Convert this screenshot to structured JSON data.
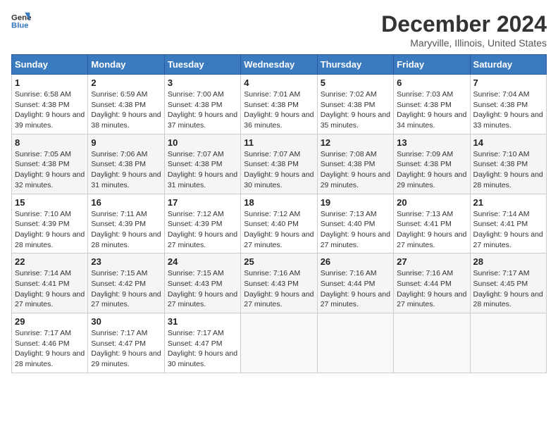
{
  "header": {
    "logo_line1": "General",
    "logo_line2": "Blue",
    "title": "December 2024",
    "subtitle": "Maryville, Illinois, United States"
  },
  "weekdays": [
    "Sunday",
    "Monday",
    "Tuesday",
    "Wednesday",
    "Thursday",
    "Friday",
    "Saturday"
  ],
  "weeks": [
    [
      {
        "day": "1",
        "sunrise": "Sunrise: 6:58 AM",
        "sunset": "Sunset: 4:38 PM",
        "daylight": "Daylight: 9 hours and 39 minutes."
      },
      {
        "day": "2",
        "sunrise": "Sunrise: 6:59 AM",
        "sunset": "Sunset: 4:38 PM",
        "daylight": "Daylight: 9 hours and 38 minutes."
      },
      {
        "day": "3",
        "sunrise": "Sunrise: 7:00 AM",
        "sunset": "Sunset: 4:38 PM",
        "daylight": "Daylight: 9 hours and 37 minutes."
      },
      {
        "day": "4",
        "sunrise": "Sunrise: 7:01 AM",
        "sunset": "Sunset: 4:38 PM",
        "daylight": "Daylight: 9 hours and 36 minutes."
      },
      {
        "day": "5",
        "sunrise": "Sunrise: 7:02 AM",
        "sunset": "Sunset: 4:38 PM",
        "daylight": "Daylight: 9 hours and 35 minutes."
      },
      {
        "day": "6",
        "sunrise": "Sunrise: 7:03 AM",
        "sunset": "Sunset: 4:38 PM",
        "daylight": "Daylight: 9 hours and 34 minutes."
      },
      {
        "day": "7",
        "sunrise": "Sunrise: 7:04 AM",
        "sunset": "Sunset: 4:38 PM",
        "daylight": "Daylight: 9 hours and 33 minutes."
      }
    ],
    [
      {
        "day": "8",
        "sunrise": "Sunrise: 7:05 AM",
        "sunset": "Sunset: 4:38 PM",
        "daylight": "Daylight: 9 hours and 32 minutes."
      },
      {
        "day": "9",
        "sunrise": "Sunrise: 7:06 AM",
        "sunset": "Sunset: 4:38 PM",
        "daylight": "Daylight: 9 hours and 31 minutes."
      },
      {
        "day": "10",
        "sunrise": "Sunrise: 7:07 AM",
        "sunset": "Sunset: 4:38 PM",
        "daylight": "Daylight: 9 hours and 31 minutes."
      },
      {
        "day": "11",
        "sunrise": "Sunrise: 7:07 AM",
        "sunset": "Sunset: 4:38 PM",
        "daylight": "Daylight: 9 hours and 30 minutes."
      },
      {
        "day": "12",
        "sunrise": "Sunrise: 7:08 AM",
        "sunset": "Sunset: 4:38 PM",
        "daylight": "Daylight: 9 hours and 29 minutes."
      },
      {
        "day": "13",
        "sunrise": "Sunrise: 7:09 AM",
        "sunset": "Sunset: 4:38 PM",
        "daylight": "Daylight: 9 hours and 29 minutes."
      },
      {
        "day": "14",
        "sunrise": "Sunrise: 7:10 AM",
        "sunset": "Sunset: 4:38 PM",
        "daylight": "Daylight: 9 hours and 28 minutes."
      }
    ],
    [
      {
        "day": "15",
        "sunrise": "Sunrise: 7:10 AM",
        "sunset": "Sunset: 4:39 PM",
        "daylight": "Daylight: 9 hours and 28 minutes."
      },
      {
        "day": "16",
        "sunrise": "Sunrise: 7:11 AM",
        "sunset": "Sunset: 4:39 PM",
        "daylight": "Daylight: 9 hours and 28 minutes."
      },
      {
        "day": "17",
        "sunrise": "Sunrise: 7:12 AM",
        "sunset": "Sunset: 4:39 PM",
        "daylight": "Daylight: 9 hours and 27 minutes."
      },
      {
        "day": "18",
        "sunrise": "Sunrise: 7:12 AM",
        "sunset": "Sunset: 4:40 PM",
        "daylight": "Daylight: 9 hours and 27 minutes."
      },
      {
        "day": "19",
        "sunrise": "Sunrise: 7:13 AM",
        "sunset": "Sunset: 4:40 PM",
        "daylight": "Daylight: 9 hours and 27 minutes."
      },
      {
        "day": "20",
        "sunrise": "Sunrise: 7:13 AM",
        "sunset": "Sunset: 4:41 PM",
        "daylight": "Daylight: 9 hours and 27 minutes."
      },
      {
        "day": "21",
        "sunrise": "Sunrise: 7:14 AM",
        "sunset": "Sunset: 4:41 PM",
        "daylight": "Daylight: 9 hours and 27 minutes."
      }
    ],
    [
      {
        "day": "22",
        "sunrise": "Sunrise: 7:14 AM",
        "sunset": "Sunset: 4:41 PM",
        "daylight": "Daylight: 9 hours and 27 minutes."
      },
      {
        "day": "23",
        "sunrise": "Sunrise: 7:15 AM",
        "sunset": "Sunset: 4:42 PM",
        "daylight": "Daylight: 9 hours and 27 minutes."
      },
      {
        "day": "24",
        "sunrise": "Sunrise: 7:15 AM",
        "sunset": "Sunset: 4:43 PM",
        "daylight": "Daylight: 9 hours and 27 minutes."
      },
      {
        "day": "25",
        "sunrise": "Sunrise: 7:16 AM",
        "sunset": "Sunset: 4:43 PM",
        "daylight": "Daylight: 9 hours and 27 minutes."
      },
      {
        "day": "26",
        "sunrise": "Sunrise: 7:16 AM",
        "sunset": "Sunset: 4:44 PM",
        "daylight": "Daylight: 9 hours and 27 minutes."
      },
      {
        "day": "27",
        "sunrise": "Sunrise: 7:16 AM",
        "sunset": "Sunset: 4:44 PM",
        "daylight": "Daylight: 9 hours and 27 minutes."
      },
      {
        "day": "28",
        "sunrise": "Sunrise: 7:17 AM",
        "sunset": "Sunset: 4:45 PM",
        "daylight": "Daylight: 9 hours and 28 minutes."
      }
    ],
    [
      {
        "day": "29",
        "sunrise": "Sunrise: 7:17 AM",
        "sunset": "Sunset: 4:46 PM",
        "daylight": "Daylight: 9 hours and 28 minutes."
      },
      {
        "day": "30",
        "sunrise": "Sunrise: 7:17 AM",
        "sunset": "Sunset: 4:47 PM",
        "daylight": "Daylight: 9 hours and 29 minutes."
      },
      {
        "day": "31",
        "sunrise": "Sunrise: 7:17 AM",
        "sunset": "Sunset: 4:47 PM",
        "daylight": "Daylight: 9 hours and 30 minutes."
      },
      null,
      null,
      null,
      null
    ]
  ]
}
